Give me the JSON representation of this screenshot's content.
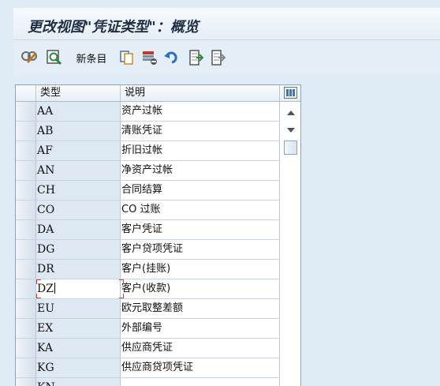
{
  "title": "更改视图\"凭证类型\"：概览",
  "toolbar": {
    "new_entries_label": "新条目",
    "icons": [
      "display-change-icon",
      "details-icon",
      "copy-icon",
      "delete-icon",
      "undo-icon",
      "select-all-icon",
      "deselect-icon"
    ]
  },
  "table": {
    "columns": {
      "type": "类型",
      "description": "说明"
    },
    "rows": [
      {
        "type": "AA",
        "description": "资产过帐"
      },
      {
        "type": "AB",
        "description": "清账凭证"
      },
      {
        "type": "AF",
        "description": "折旧过帐"
      },
      {
        "type": "AN",
        "description": "净资产过帐"
      },
      {
        "type": "CH",
        "description": "合同结算"
      },
      {
        "type": "CO",
        "description": "CO 过账"
      },
      {
        "type": "DA",
        "description": "客户凭证"
      },
      {
        "type": "DG",
        "description": "客户贷项凭证"
      },
      {
        "type": "DR",
        "description": "客户(挂账)"
      },
      {
        "type": "DZ",
        "description": "客户(收款)"
      },
      {
        "type": "EU",
        "description": "欧元取整差额"
      },
      {
        "type": "EX",
        "description": "外部编号"
      },
      {
        "type": "KA",
        "description": "供应商凭证"
      },
      {
        "type": "KG",
        "description": "供应商贷项凭证"
      },
      {
        "type": "KN",
        "description": ""
      }
    ]
  },
  "colors": {
    "title_bar": "#e9f1f8",
    "background": "#dfebf5",
    "key_column": "#dde8f3",
    "focus": "#d43b2b"
  }
}
